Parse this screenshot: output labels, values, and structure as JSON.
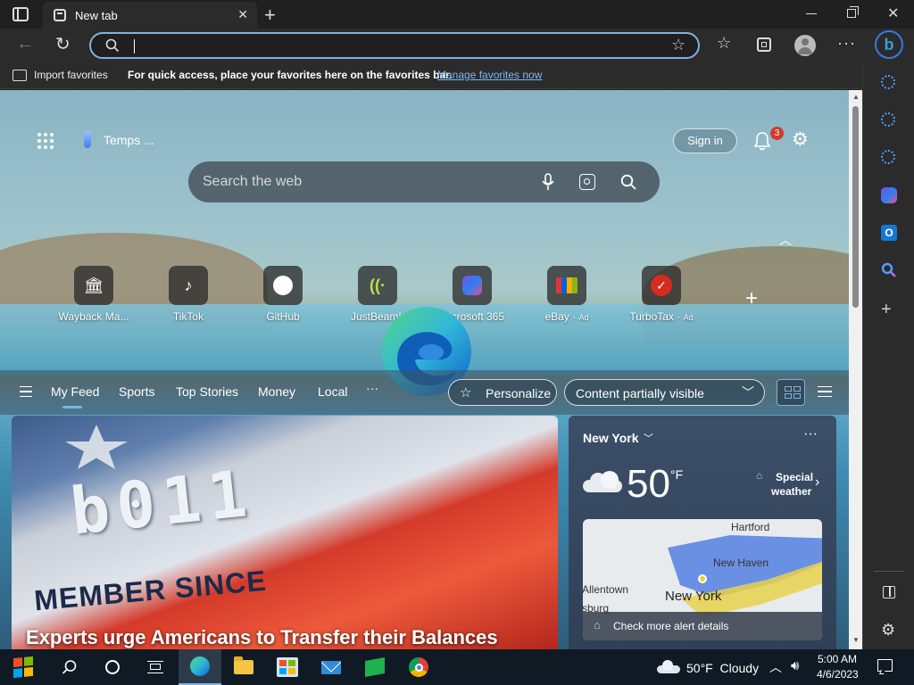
{
  "browser": {
    "tab": {
      "title": "New tab"
    },
    "address": {
      "value": "",
      "placeholder": ""
    },
    "favorites_bar": {
      "import_label": "Import favorites",
      "message": "For quick access, place your favorites here on the favorites bar.",
      "manage_link": "Manage favorites now"
    }
  },
  "newtab": {
    "weather_pill": "Temps ...",
    "sign_in": "Sign in",
    "notifications_count": "3",
    "search_placeholder": "Search the web",
    "top_sites": [
      {
        "label": "Wayback Ma...",
        "icon": "museum-icon",
        "ad": ""
      },
      {
        "label": "TikTok",
        "icon": "tiktok-icon",
        "ad": ""
      },
      {
        "label": "GitHub",
        "icon": "github-icon",
        "ad": ""
      },
      {
        "label": "JustBeamIt",
        "icon": "signal-icon",
        "ad": ""
      },
      {
        "label": "Microsoft 365",
        "icon": "m365-icon",
        "ad": ""
      },
      {
        "label": "eBay",
        "icon": "ebay-bag-icon",
        "ad": "Ad"
      },
      {
        "label": "TurboTax",
        "icon": "checkmark-icon",
        "ad": "Ad"
      }
    ],
    "feed_tabs": [
      "My Feed",
      "Sports",
      "Top Stories",
      "Money",
      "Local"
    ],
    "more": "···",
    "personalize": "Personalize",
    "content_visibility": "Content partially visible",
    "hero_headline": "Experts urge Americans to Transfer their Balances",
    "hero_photo_text": {
      "line1": "b011",
      "line2": "MEMBER SINCE"
    },
    "weather": {
      "location": "New York",
      "temp": "50",
      "unit": "°F",
      "alert_line1": "Special",
      "alert_line2": "weather",
      "map_labels": [
        "Hartford",
        "New Haven",
        "Allentown",
        "New York",
        "sburg"
      ],
      "check_alert": "Check more alert details",
      "more": "···"
    }
  },
  "taskbar": {
    "weather": "50°F  Cloudy",
    "time": "5:00 AM",
    "date": "4/6/2023"
  },
  "colors": {
    "accent": "#7fb2e0",
    "edge_blue": "#1f7fe0",
    "edge_green": "#4fd18b",
    "link": "#7fb8f5"
  }
}
